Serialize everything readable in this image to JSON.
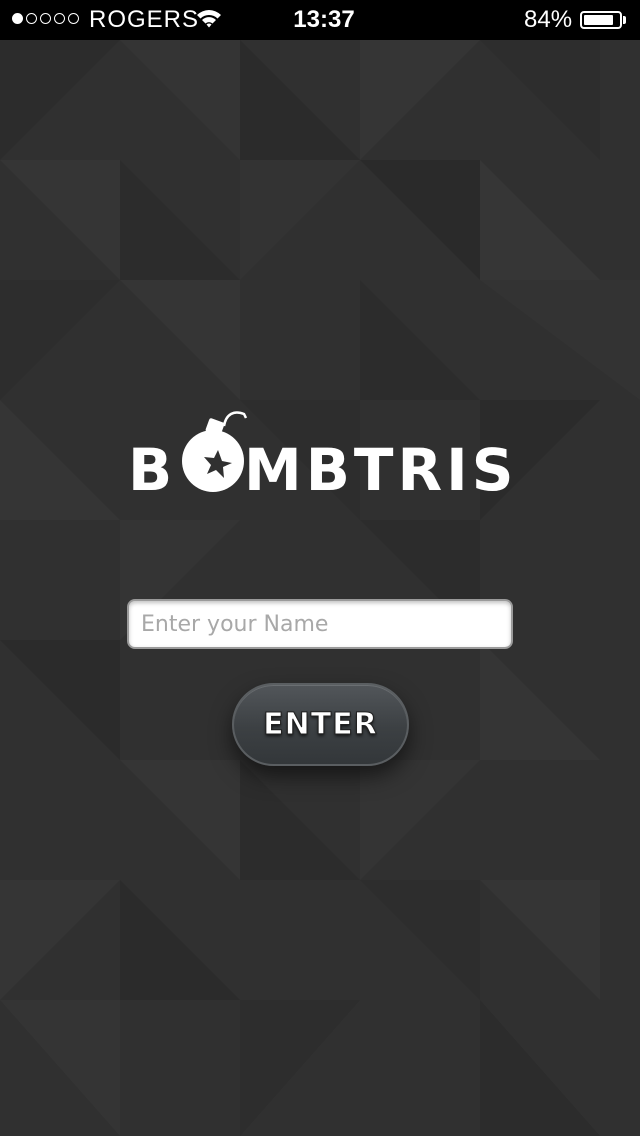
{
  "status_bar": {
    "signal_bars_filled": 1,
    "signal_bars_total": 5,
    "carrier": "ROGERS",
    "wifi_icon": "wifi-icon",
    "time": "13:37",
    "battery_percent": "84%",
    "battery_level": 0.84
  },
  "logo": {
    "first_letter": "B",
    "rest_letters": "MBTRIS",
    "bomb_icon": "bomb-icon"
  },
  "form": {
    "name_value": "",
    "name_placeholder": "Enter your Name",
    "enter_label": "ENTER"
  },
  "colors": {
    "background": "#303030",
    "status_bar": "#000000",
    "button": "#3c4043",
    "text": "#ffffff"
  }
}
